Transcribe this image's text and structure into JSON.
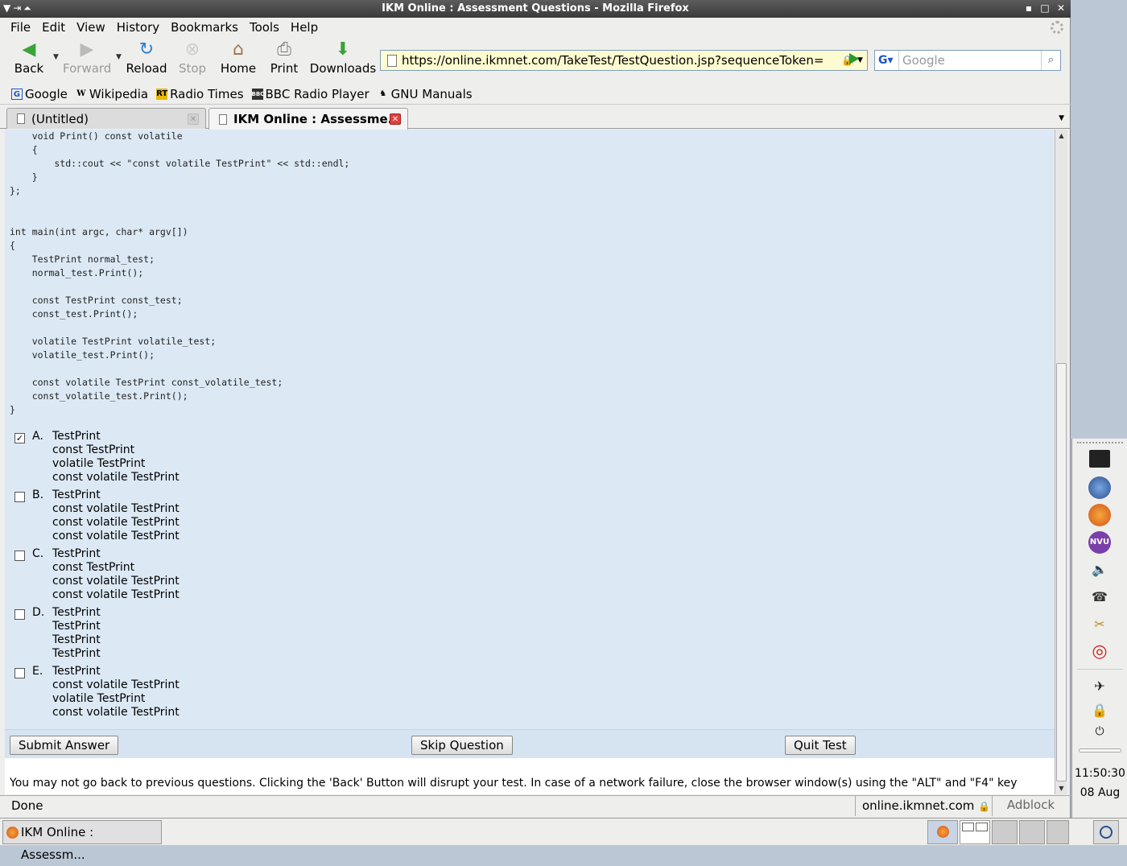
{
  "window": {
    "title": "IKM Online : Assessment Questions - Mozilla Firefox"
  },
  "menu": [
    "File",
    "Edit",
    "View",
    "History",
    "Bookmarks",
    "Tools",
    "Help"
  ],
  "toolbar": {
    "back": "Back",
    "forward": "Forward",
    "reload": "Reload",
    "stop": "Stop",
    "home": "Home",
    "print": "Print",
    "downloads": "Downloads"
  },
  "url": "https://online.ikmnet.com/TakeTest/TestQuestion.jsp?sequenceToken=",
  "search": {
    "placeholder": "Google"
  },
  "bookmarks": [
    "Google",
    "Wikipedia",
    "Radio Times",
    "BBC Radio Player",
    "GNU Manuals"
  ],
  "tabs": [
    "(Untitled)",
    "IKM Online : Assessme..."
  ],
  "code": "    void Print() const volatile\n    {\n        std::cout << \"const volatile TestPrint\" << std::endl;\n    }\n};\n\n\nint main(int argc, char* argv[])\n{\n    TestPrint normal_test;\n    normal_test.Print();\n\n    const TestPrint const_test;\n    const_test.Print();\n\n    volatile TestPrint volatile_test;\n    volatile_test.Print();\n\n    const volatile TestPrint const_volatile_test;\n    const_volatile_test.Print();\n}",
  "answers": [
    {
      "letter": "A.",
      "checked": true,
      "lines": [
        "TestPrint",
        "const TestPrint",
        "volatile TestPrint",
        "const volatile TestPrint"
      ]
    },
    {
      "letter": "B.",
      "checked": false,
      "lines": [
        "TestPrint",
        "const volatile TestPrint",
        "const volatile TestPrint",
        "const volatile TestPrint"
      ]
    },
    {
      "letter": "C.",
      "checked": false,
      "lines": [
        "TestPrint",
        "const TestPrint",
        "const volatile TestPrint",
        "const volatile TestPrint"
      ]
    },
    {
      "letter": "D.",
      "checked": false,
      "lines": [
        "TestPrint",
        "TestPrint",
        "TestPrint",
        "TestPrint"
      ]
    },
    {
      "letter": "E.",
      "checked": false,
      "lines": [
        "TestPrint",
        "const volatile TestPrint",
        "volatile TestPrint",
        "const volatile TestPrint"
      ]
    }
  ],
  "buttons": {
    "submit": "Submit Answer",
    "skip": "Skip Question",
    "quit": "Quit Test"
  },
  "notice": "You may not go back to previous questions. Clicking the 'Back' Button will disrupt your test. In case of a network failure, close the browser window(s) using the \"ALT\" and \"F4\" key",
  "status": {
    "text": "Done",
    "host": "online.ikmnet.com",
    "adblock": "Adblock"
  },
  "clock": {
    "time": "11:50:30",
    "date": "08 Aug"
  },
  "taskbar": {
    "item": "IKM Online : Assessm..."
  }
}
